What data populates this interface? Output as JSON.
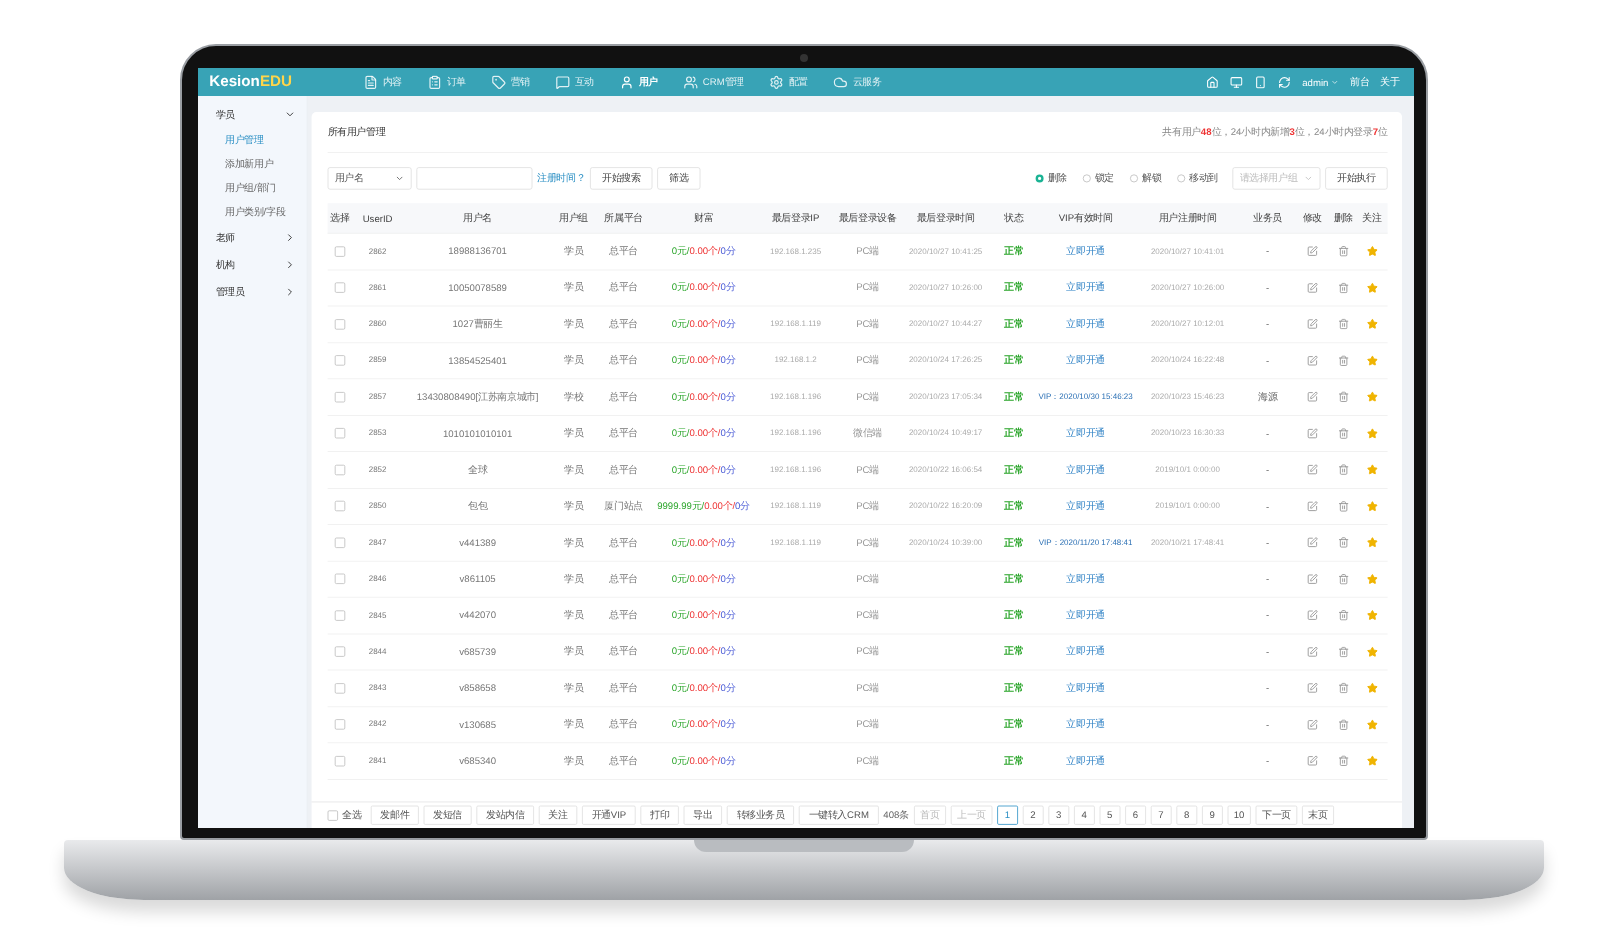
{
  "brand": {
    "name": "Kesion",
    "accent": "EDU"
  },
  "nav": [
    {
      "label": "内容",
      "selected": false
    },
    {
      "label": "订单",
      "selected": false
    },
    {
      "label": "营销",
      "selected": false
    },
    {
      "label": "互动",
      "selected": false
    },
    {
      "label": "用户",
      "selected": true
    },
    {
      "label": "CRM管理",
      "selected": false
    },
    {
      "label": "配置",
      "selected": false
    },
    {
      "label": "云服务",
      "selected": false
    }
  ],
  "header_tools": {
    "user": "admin",
    "links": [
      "前台",
      "关于"
    ]
  },
  "sidebar": [
    {
      "label": "学员",
      "expanded": true,
      "children": [
        {
          "label": "用户管理",
          "selected": true
        },
        {
          "label": "添加新用户",
          "selected": false
        },
        {
          "label": "用户组/部门",
          "selected": false
        },
        {
          "label": "用户类别/字段",
          "selected": false
        }
      ]
    },
    {
      "label": "老师",
      "expanded": false
    },
    {
      "label": "机构",
      "expanded": false
    },
    {
      "label": "管理员",
      "expanded": false
    }
  ],
  "page_title": "所有用户管理",
  "summary": "共有用户**48**位，24小时内新增**3**位，24小时内登录**7**位",
  "search": {
    "field": "用户名",
    "link": "注册时间？",
    "buttons": [
      "开始搜索",
      "筛选"
    ]
  },
  "batch": {
    "options": [
      {
        "label": "删除",
        "selected": true
      },
      {
        "label": "锁定",
        "selected": false
      },
      {
        "label": "解锁",
        "selected": false
      },
      {
        "label": "移动到",
        "selected": false
      }
    ],
    "group_select": "请选择用户组",
    "button": "开始执行"
  },
  "table": {
    "columns": [
      "选择",
      "UserID",
      "用户名",
      "用户组",
      "所属平台",
      "财富",
      "最后登录IP",
      "最后登录设备",
      "最后登录时间",
      "状态",
      "VIP有效时间",
      "用户注册时间",
      "业务员",
      "修改",
      "删除",
      "关注"
    ],
    "rows": [
      {
        "id": "2862",
        "name": "18988136701",
        "group": "学员",
        "platform": "总平台",
        "wealth": {
          "money": "0元/",
          "points": "0.00个/",
          "score": "0分"
        },
        "ip": "192.168.1.235",
        "device": "PC端",
        "last_login": "2020/10/27 10:41:25",
        "status": "正常",
        "vip": {
          "kind": "link",
          "text": "立即开通"
        },
        "registered": "2020/10/27 10:41:01",
        "agent": "-",
        "checked": false
      },
      {
        "id": "2861",
        "name": "10050078589",
        "group": "学员",
        "platform": "总平台",
        "wealth": {
          "money": "0元/",
          "points": "0.00个/",
          "score": "0分"
        },
        "device": "PC端",
        "last_login": "2020/10/27 10:26:00",
        "status": "正常",
        "vip": {
          "kind": "link",
          "text": "立即开通"
        },
        "registered": "2020/10/27 10:26:00",
        "agent": "-",
        "checked": false
      },
      {
        "id": "2860",
        "name": "1027曹丽生",
        "group": "学员",
        "platform": "总平台",
        "wealth": {
          "money": "0元/",
          "points": "0.00个/",
          "score": "0分"
        },
        "ip": "192.168.1.119",
        "device": "PC端",
        "last_login": "2020/10/27 10:44:27",
        "status": "正常",
        "vip": {
          "kind": "link",
          "text": "立即开通"
        },
        "registered": "2020/10/27 10:12:01",
        "agent": "-",
        "checked": false
      },
      {
        "id": "2859",
        "name": "13854525401",
        "group": "学员",
        "platform": "总平台",
        "wealth": {
          "money": "0元/",
          "points": "0.00个/",
          "score": "0分"
        },
        "ip": "192.168.1.2",
        "device": "PC端",
        "last_login": "2020/10/24 17:26:25",
        "status": "正常",
        "vip": {
          "kind": "link",
          "text": "立即开通"
        },
        "registered": "2020/10/24 16:22:48",
        "agent": "-",
        "checked": false
      },
      {
        "id": "2857",
        "name": "13430808490[江苏南京城市]",
        "group": "学校",
        "platform": "总平台",
        "wealth": {
          "money": "0元/",
          "points": "0.00个/",
          "score": "0分"
        },
        "ip": "192.168.1.196",
        "device": "PC端",
        "last_login": "2020/10/23 17:05:34",
        "status": "正常",
        "vip": {
          "kind": "date",
          "text": "VIP：2020/10/30 15:46:23"
        },
        "registered": "2020/10/23 15:46:23",
        "agent": "海源",
        "checked": false
      },
      {
        "id": "2853",
        "name": "1010101010101",
        "group": "学员",
        "platform": "总平台",
        "wealth": {
          "money": "0元/",
          "points": "0.00个/",
          "score": "0分"
        },
        "ip": "192.168.1.196",
        "device": "微信端",
        "last_login": "2020/10/24 10:49:17",
        "status": "正常",
        "vip": {
          "kind": "link",
          "text": "立即开通"
        },
        "registered": "2020/10/23 16:30:33",
        "agent": "-",
        "checked": false
      },
      {
        "id": "2852",
        "name": "全球",
        "group": "学员",
        "platform": "总平台",
        "wealth": {
          "money": "0元/",
          "points": "0.00个/",
          "score": "0分"
        },
        "ip": "192.168.1.196",
        "device": "PC端",
        "last_login": "2020/10/22 16:06:54",
        "status": "正常",
        "vip": {
          "kind": "link",
          "text": "立即开通"
        },
        "registered": "2019/10/1 0:00:00",
        "agent": "-",
        "checked": false
      },
      {
        "id": "2850",
        "name": "包包",
        "group": "学员",
        "platform": "厦门站点",
        "wealth": {
          "money": "9999.99元/",
          "points": "0.00个/",
          "score": "0分"
        },
        "ip": "192.168.1.119",
        "device": "PC端",
        "last_login": "2020/10/22 16:20:09",
        "status": "正常",
        "vip": {
          "kind": "link",
          "text": "立即开通"
        },
        "registered": "2019/10/1 0:00:00",
        "agent": "-",
        "checked": false
      },
      {
        "id": "2847",
        "name": "v441389",
        "group": "学员",
        "platform": "总平台",
        "wealth": {
          "money": "0元/",
          "points": "0.00个/",
          "score": "0分"
        },
        "ip": "192.168.1.119",
        "device": "PC端",
        "last_login": "2020/10/24 10:39:00",
        "status": "正常",
        "vip": {
          "kind": "date",
          "text": "VIP：2020/11/20 17:48:41"
        },
        "registered": "2020/10/21 17:48:41",
        "agent": "-",
        "checked": false
      },
      {
        "id": "2846",
        "name": "v861105",
        "group": "学员",
        "platform": "总平台",
        "wealth": {
          "money": "0元/",
          "points": "0.00个/",
          "score": "0分"
        },
        "device": "PC端",
        "status": "正常",
        "vip": {
          "kind": "link",
          "text": "立即开通"
        },
        "agent": "-",
        "checked": false
      },
      {
        "id": "2845",
        "name": "v442070",
        "group": "学员",
        "platform": "总平台",
        "wealth": {
          "money": "0元/",
          "points": "0.00个/",
          "score": "0分"
        },
        "device": "PC端",
        "status": "正常",
        "vip": {
          "kind": "link",
          "text": "立即开通"
        },
        "agent": "-",
        "checked": false
      },
      {
        "id": "2844",
        "name": "v685739",
        "group": "学员",
        "platform": "总平台",
        "wealth": {
          "money": "0元/",
          "points": "0.00个/",
          "score": "0分"
        },
        "device": "PC端",
        "status": "正常",
        "vip": {
          "kind": "link",
          "text": "立即开通"
        },
        "agent": "-",
        "checked": false
      },
      {
        "id": "2843",
        "name": "v858658",
        "group": "学员",
        "platform": "总平台",
        "wealth": {
          "money": "0元/",
          "points": "0.00个/",
          "score": "0分"
        },
        "device": "PC端",
        "status": "正常",
        "vip": {
          "kind": "link",
          "text": "立即开通"
        },
        "agent": "-",
        "checked": false
      },
      {
        "id": "2842",
        "name": "v130685",
        "group": "学员",
        "platform": "总平台",
        "wealth": {
          "money": "0元/",
          "points": "0.00个/",
          "score": "0分"
        },
        "device": "PC端",
        "status": "正常",
        "vip": {
          "kind": "link",
          "text": "立即开通"
        },
        "agent": "-",
        "checked": false
      },
      {
        "id": "2841",
        "name": "v685340",
        "group": "学员",
        "platform": "总平台",
        "wealth": {
          "money": "0元/",
          "points": "0.00个/",
          "score": "0分"
        },
        "device": "PC端",
        "status": "正常",
        "vip": {
          "kind": "link",
          "text": "立即开通"
        },
        "agent": "-",
        "checked": false
      }
    ]
  },
  "footer": {
    "select_all": {
      "label": "全选",
      "checked": false
    },
    "buttons": [
      "发邮件",
      "发短信",
      "发站内信",
      "关注",
      "开通VIP",
      "打印",
      "导出",
      "转移业务员",
      "一键转入CRM"
    ],
    "total": "408条",
    "pager": {
      "first": "首页",
      "prev": "上一页",
      "pages": [
        {
          "label": "1",
          "selected": true
        },
        {
          "label": "2",
          "selected": false
        },
        {
          "label": "3",
          "selected": false
        },
        {
          "label": "4",
          "selected": false
        },
        {
          "label": "5",
          "selected": false
        },
        {
          "label": "6",
          "selected": false
        },
        {
          "label": "7",
          "selected": false
        },
        {
          "label": "8",
          "selected": false
        },
        {
          "label": "9",
          "selected": false
        },
        {
          "label": "10",
          "selected": false
        }
      ],
      "next": "下一页",
      "last": "末页"
    }
  }
}
